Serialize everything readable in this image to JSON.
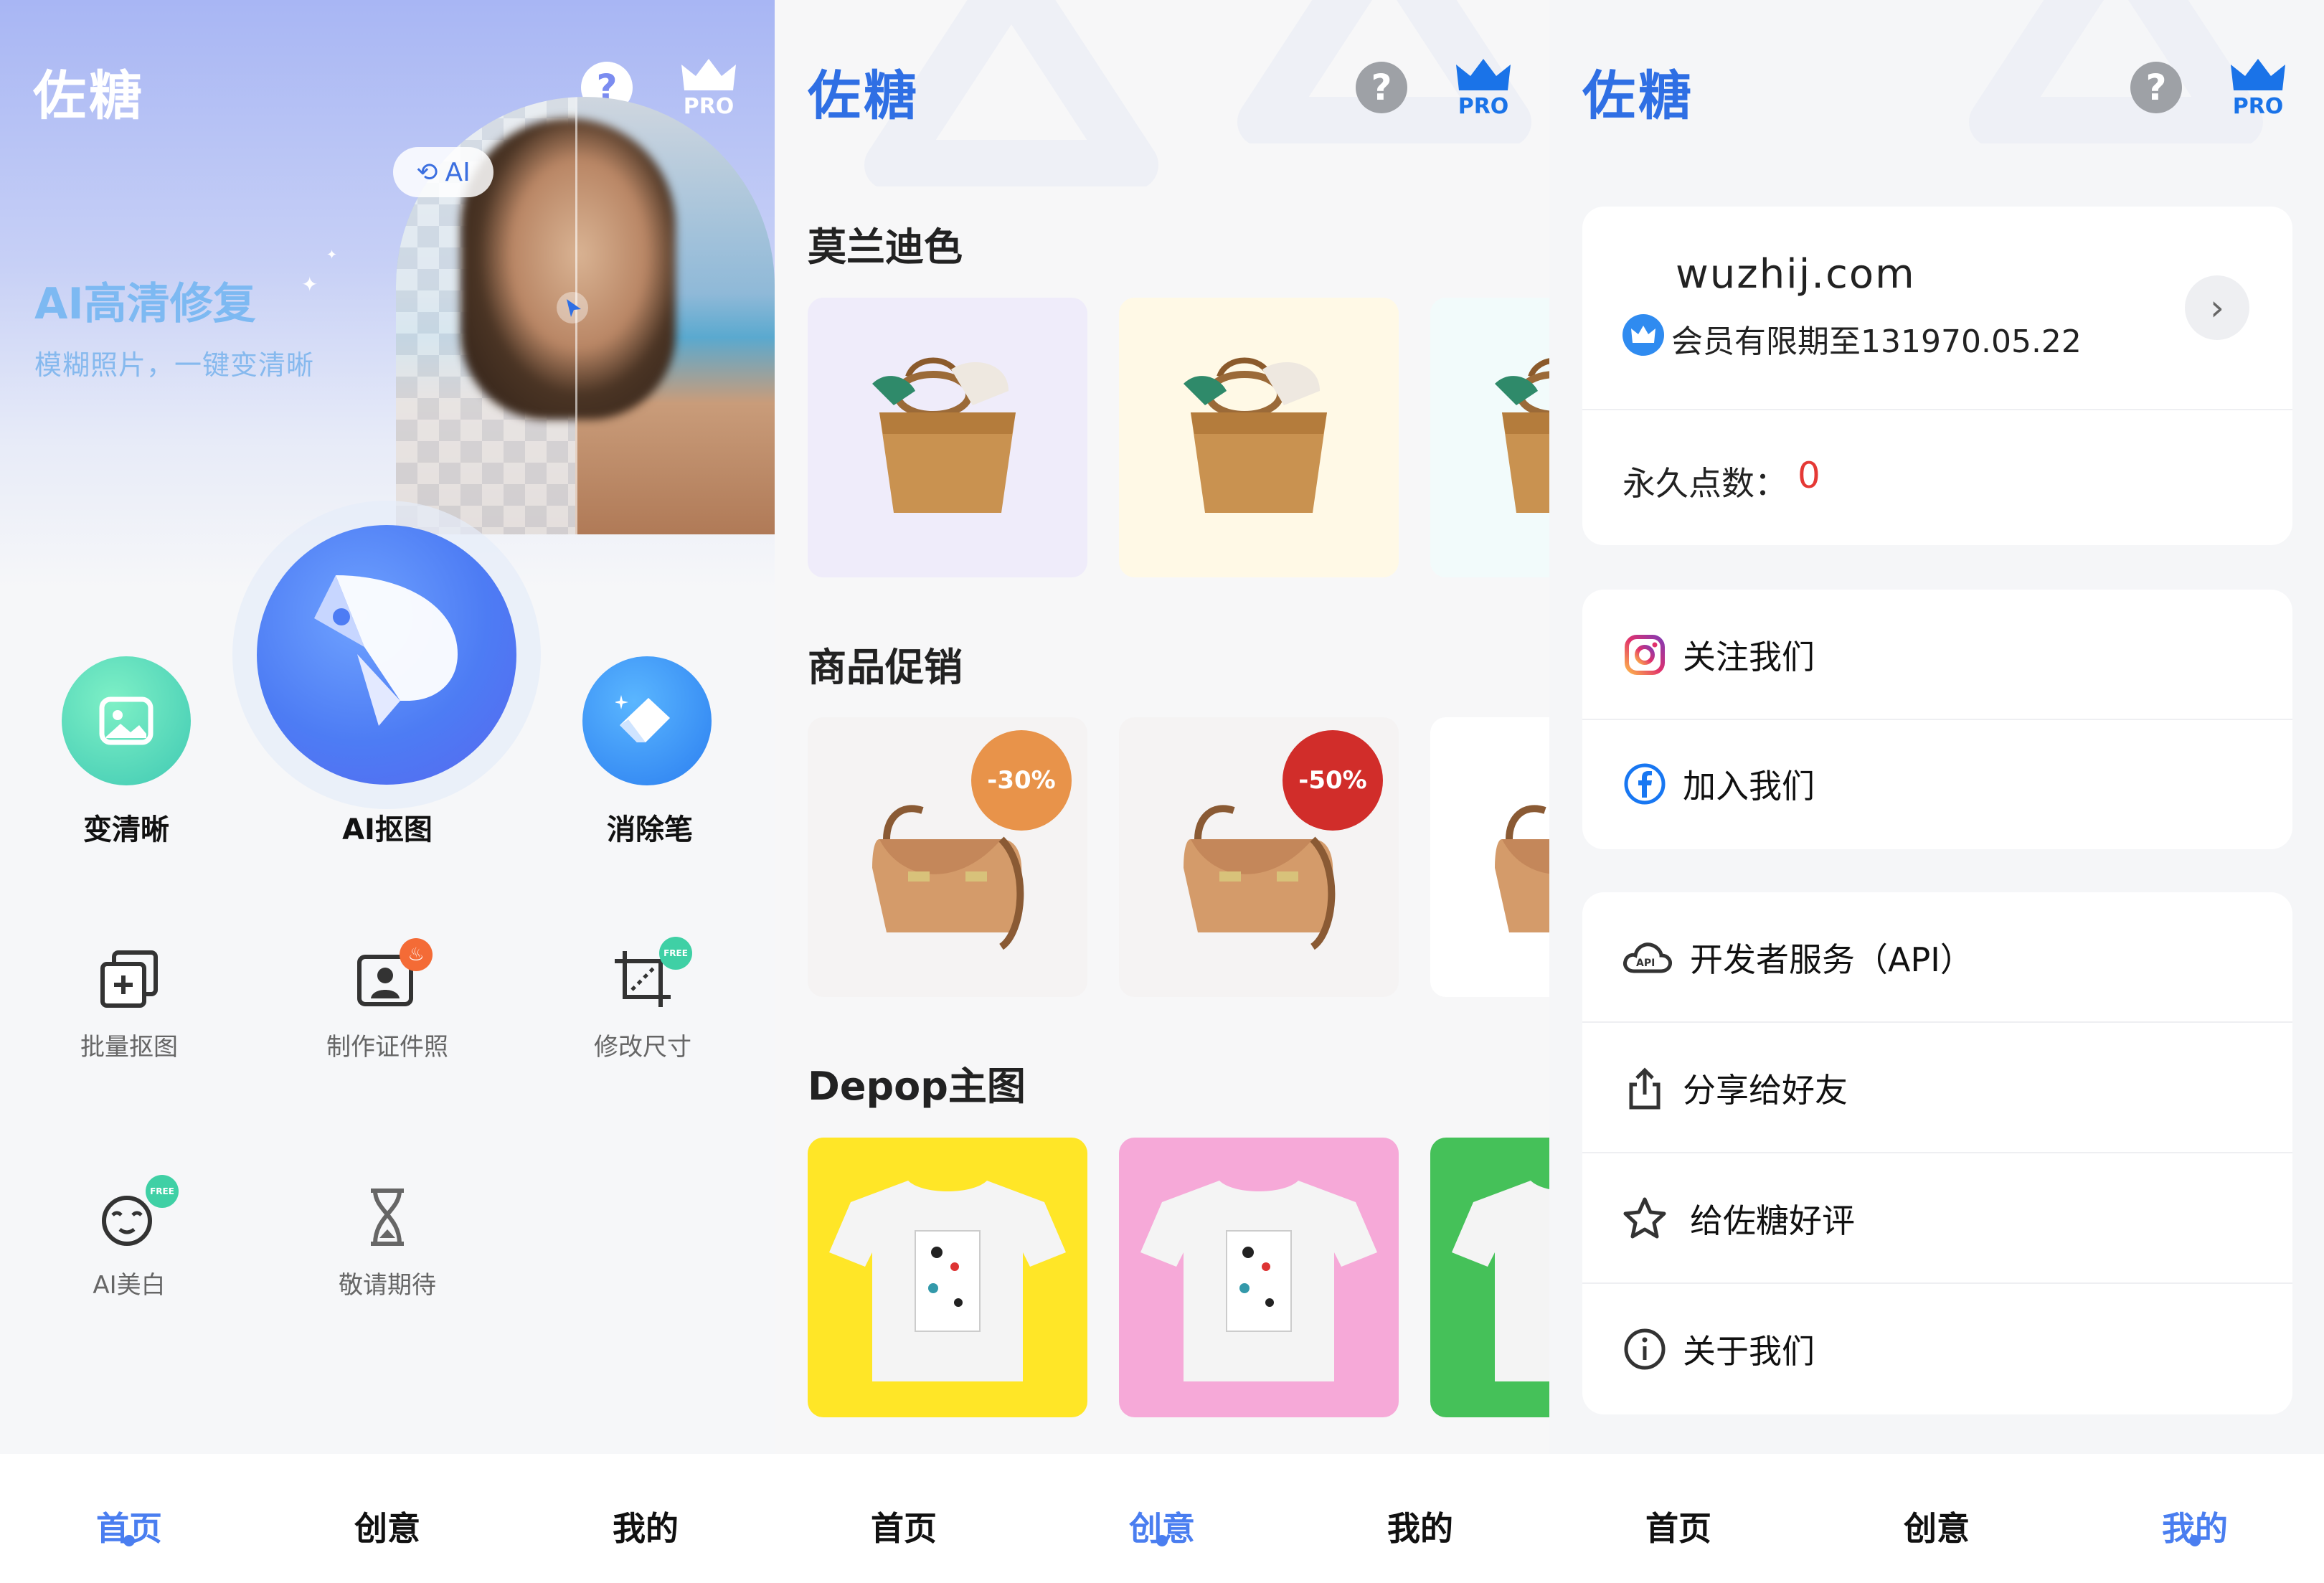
{
  "app": {
    "title": "佐糖",
    "help_icon": "?",
    "pro_label": "PRO"
  },
  "panel1": {
    "hero": {
      "ai_badge": "AI",
      "title": "AI高清修复",
      "subtitle": "模糊照片，一键变清晰"
    },
    "primary_actions": [
      {
        "label": "变清晰",
        "icon": "hd-image-icon"
      },
      {
        "label": "AI抠图",
        "icon": "ai-cutout-icon"
      },
      {
        "label": "消除笔",
        "icon": "eraser-icon"
      }
    ],
    "tools": [
      {
        "label": "批量抠图",
        "icon": "batch-cutout-icon",
        "badge": ""
      },
      {
        "label": "制作证件照",
        "icon": "id-photo-icon",
        "badge": "hot"
      },
      {
        "label": "修改尺寸",
        "icon": "resize-icon",
        "badge": "FREE"
      },
      {
        "label": "AI美白",
        "icon": "whitening-icon",
        "badge": "FREE"
      },
      {
        "label": "敬请期待",
        "icon": "hourglass-icon",
        "badge": ""
      }
    ],
    "tabs": {
      "active": 0
    }
  },
  "panel2": {
    "sections": [
      {
        "title": "莫兰迪色",
        "card_colors": [
          "#efecfa",
          "#fff9e6",
          "#f2fbfb"
        ]
      },
      {
        "title": "商品促销",
        "badges": [
          "-30%",
          "-50%"
        ],
        "badge_colors": [
          "#e8934a",
          "#d12d2a"
        ]
      },
      {
        "title": "Depop主图",
        "card_colors": [
          "#ffe627",
          "#f6a9d8",
          "#45c159"
        ]
      }
    ],
    "tabs": {
      "active": 1
    }
  },
  "panel3": {
    "profile": {
      "name": "wuzhij.com",
      "member_text": "会员有限期至131970.05.22"
    },
    "points": {
      "label": "永久点数：",
      "value": "0"
    },
    "social": [
      {
        "label": "关注我们",
        "icon": "instagram-icon"
      },
      {
        "label": "加入我们",
        "icon": "facebook-icon"
      }
    ],
    "more": [
      {
        "label": "开发者服务（API）",
        "icon": "api-cloud-icon"
      },
      {
        "label": "分享给好友",
        "icon": "share-icon"
      },
      {
        "label": "给佐糖好评",
        "icon": "star-icon"
      },
      {
        "label": "关于我们",
        "icon": "info-icon"
      }
    ],
    "tabs": {
      "active": 2
    }
  },
  "tabbar": {
    "home": "首页",
    "creative": "创意",
    "mine": "我的"
  },
  "colors": {
    "accent": "#4a7ef0",
    "brand_blue": "#2f6fe4",
    "points_red": "#e53935"
  }
}
